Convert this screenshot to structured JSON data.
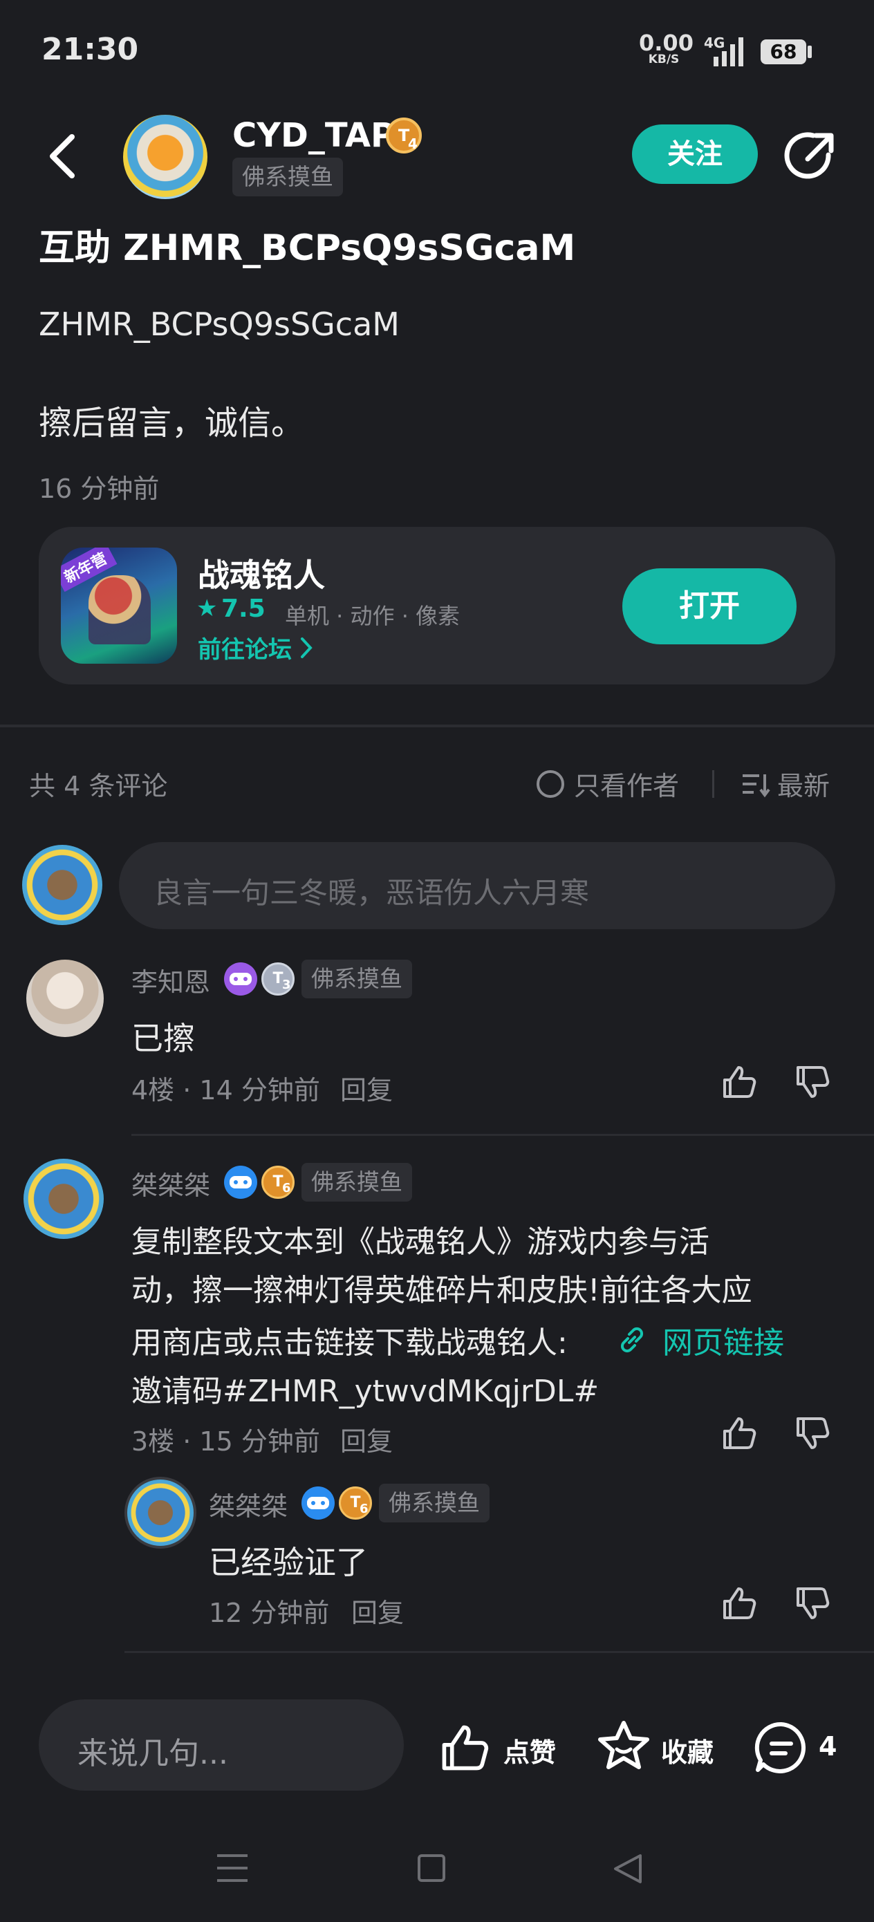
{
  "status_bar": {
    "time": "21:30",
    "net_speed": "0.00",
    "net_unit": "KB/S",
    "signal": "4G",
    "battery": "68"
  },
  "header": {
    "username": "CYD_TAP",
    "level": "4",
    "user_tag": "佛系摸鱼",
    "follow_label": "关注"
  },
  "post": {
    "title": "互助 ZHMR_BCPsQ9sSGcaM",
    "body_line1": "ZHMR_BCPsQ9sSGcaM",
    "body_line2": "擦后留言，诚信。",
    "time": "16 分钟前"
  },
  "game_card": {
    "badge": "新年营",
    "name": "战魂铭人",
    "rating": "7.5",
    "tags": "单机 · 动作 · 像素",
    "forum_link": "前往论坛",
    "open_label": "打开"
  },
  "comments_header": {
    "count_label": "共 4 条评论",
    "author_only_label": "只看作者",
    "sort_label": "最新"
  },
  "comment_input": {
    "placeholder": "良言一句三冬暖，恶语伤人六月寒"
  },
  "comments": [
    {
      "user": "李知恩",
      "level": "3",
      "tag": "佛系摸鱼",
      "text": "已擦",
      "floor_time": "4楼 · 14 分钟前",
      "reply": "回复"
    },
    {
      "user": "桀桀桀",
      "level": "6",
      "tag": "佛系摸鱼",
      "text_line1": "复制整段文本到《战魂铭人》游戏内参与活",
      "text_line2": "动，擦一擦神灯得英雄碎片和皮肤!前往各大应",
      "text_line3": "用商店或点击链接下载战魂铭人:",
      "link_text": "网页链接",
      "text_line4": "邀请码#ZHMR_ytwvdMKqjrDL#",
      "floor_time": "3楼 · 15 分钟前",
      "reply": "回复"
    }
  ],
  "sub_reply": {
    "user": "桀桀桀",
    "level": "6",
    "tag": "佛系摸鱼",
    "text": "已经验证了",
    "time": "12 分钟前",
    "reply": "回复"
  },
  "bottom_bar": {
    "input_placeholder": "来说几句...",
    "like_label": "点赞",
    "fav_label": "收藏",
    "comment_count": "4"
  },
  "colors": {
    "background": "#1c1d21",
    "accent": "#15b8a6",
    "card": "#2a2b30",
    "muted_text": "#8a8b90"
  }
}
